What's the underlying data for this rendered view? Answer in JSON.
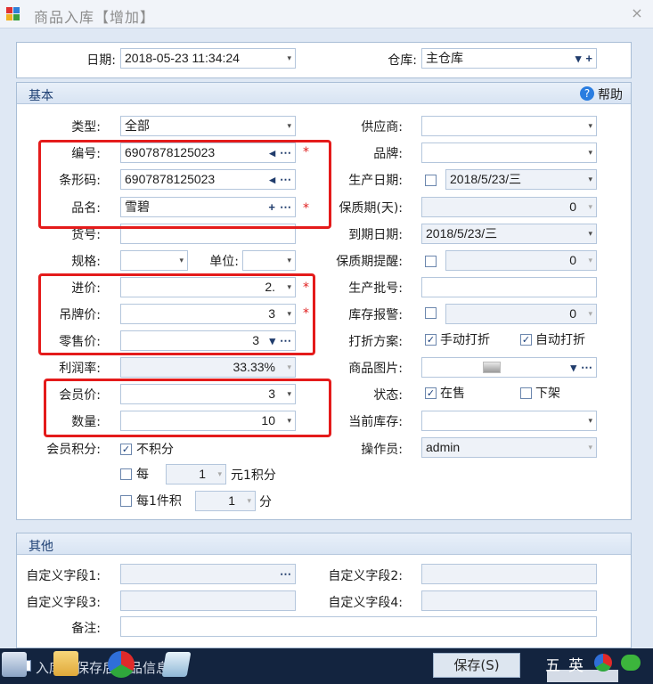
{
  "window": {
    "title": "商品入库【增加】",
    "close": "×"
  },
  "top": {
    "date_label": "日期:",
    "date_value": "2018-05-23 11:34:24",
    "warehouse_label": "仓库:",
    "warehouse_value": "主仓库"
  },
  "basic": {
    "title": "基本",
    "help": "帮助",
    "type_label": "类型:",
    "type_value": "全部",
    "code_label": "编号:",
    "code_value": "6907878125023",
    "barcode_label": "条形码:",
    "barcode_value": "6907878125023",
    "name_label": "品名:",
    "name_value": "雪碧",
    "itemno_label": "货号:",
    "itemno_value": "",
    "spec_label": "规格:",
    "unit_label": "单位:",
    "purchase_label": "进价:",
    "purchase_value": "2.",
    "tag_label": "吊牌价:",
    "tag_value": "3",
    "retail_label": "零售价:",
    "retail_value": "3",
    "profit_label": "利润率:",
    "profit_value": "33.33%",
    "member_price_label": "会员价:",
    "member_price_value": "3",
    "qty_label": "数量:",
    "qty_value": "10",
    "points_label": "会员积分:",
    "no_points": "不积分",
    "every": "每",
    "every_value": "1",
    "every_suffix": "元1积分",
    "per_item": "每1件积",
    "per_item_value": "1",
    "per_item_suffix": "分",
    "supplier_label": "供应商:",
    "brand_label": "品牌:",
    "mfg_label": "生产日期:",
    "mfg_value": "2018/5/23/三",
    "shelf_label": "保质期(天):",
    "shelf_value": "0",
    "expiry_label": "到期日期:",
    "expiry_value": "2018/5/23/三",
    "shelf_remind_label": "保质期提醒:",
    "shelf_remind_value": "0",
    "batch_label": "生产批号:",
    "stock_alert_label": "库存报警:",
    "stock_alert_value": "0",
    "discount_label": "打折方案:",
    "manual_discount": "手动打折",
    "auto_discount": "自动打折",
    "image_label": "商品图片:",
    "status_label": "状态:",
    "on_sale": "在售",
    "off_shelf": "下架",
    "current_stock_label": "当前库存:",
    "operator_label": "操作员:",
    "operator_value": "admin"
  },
  "other": {
    "title": "其他",
    "custom1": "自定义字段1:",
    "custom2": "自定义字段2:",
    "custom3": "自定义字段3:",
    "custom4": "自定义字段4:",
    "remark": "备注:"
  },
  "footer": {
    "checkbox_text": "入库后保存后商品信息",
    "save": "保存(S)"
  },
  "tray": {
    "ime1": "五",
    "ime2": "英"
  },
  "required_mark": "*",
  "icons": {
    "more": "⋯",
    "add": "+",
    "left": "◂",
    "dropdown": "▾"
  }
}
